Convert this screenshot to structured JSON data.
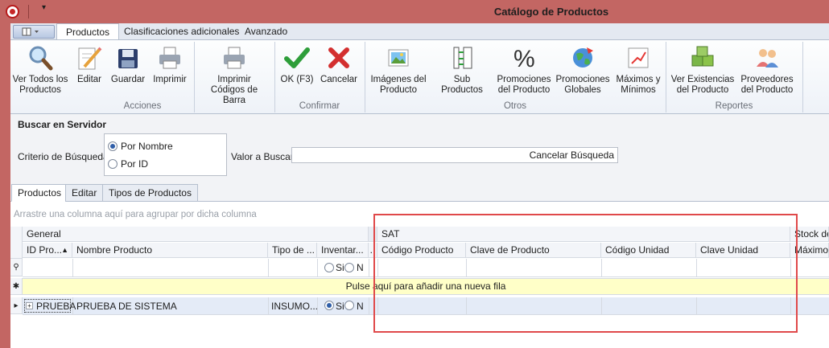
{
  "window": {
    "title": "Catálogo de Productos"
  },
  "ribbon_tabs": [
    "Productos",
    "Clasificaciones adicionales",
    "Avanzado"
  ],
  "ribbon": {
    "buttons": [
      {
        "label": "Ver Todos los Productos",
        "icon": "magnifier-icon"
      },
      {
        "label": "Editar",
        "icon": "pencil-paper-icon"
      },
      {
        "label": "Guardar",
        "icon": "floppy-disk-icon"
      },
      {
        "label": "Imprimir",
        "icon": "printer-icon"
      },
      {
        "label": "Imprimir Códigos de Barra",
        "icon": "printer-icon"
      },
      {
        "label": "OK (F3)",
        "icon": "green-check-icon"
      },
      {
        "label": "Cancelar",
        "icon": "red-x-icon"
      },
      {
        "label": "Imágenes del Producto",
        "icon": "picture-icon"
      },
      {
        "label": "Sub Productos",
        "icon": "tree-icon"
      },
      {
        "label": "Promociones del Producto",
        "icon": "percent-icon"
      },
      {
        "label": "Promociones Globales",
        "icon": "globe-icon"
      },
      {
        "label": "Máximos y Mínimos",
        "icon": "chart-icon"
      },
      {
        "label": "Ver Existencias del Producto",
        "icon": "boxes-icon"
      },
      {
        "label": "Proveedores del Producto",
        "icon": "people-icon"
      }
    ],
    "groups": [
      "Acciones",
      "Confirmar",
      "Otros",
      "Reportes"
    ]
  },
  "search": {
    "title": "Buscar en Servidor",
    "criteria_label": "Criterio de Búsqueda",
    "options": [
      "Por Nombre",
      "Por ID"
    ],
    "selected": "Por Nombre",
    "value_label": "Valor a Buscar",
    "value": "",
    "cancel_label": "Cancelar Búsqueda"
  },
  "tabs": [
    "Productos",
    "Editar",
    "Tipos de Productos"
  ],
  "grid": {
    "group_hint": "Arrastre una columna aquí para agrupar por dicha columna",
    "bands": [
      "General",
      "SAT",
      "Stock de"
    ],
    "columns": [
      "ID Pro...",
      "Nombre Producto",
      "Tipo de ...",
      "Inventar...",
      "Código Producto",
      "Clave de Producto",
      "Código Unidad",
      "Clave Unidad",
      "Máximo"
    ],
    "filter_radio": {
      "si": "Si",
      "no": "N"
    },
    "new_row_text": "Pulse aquí para añadir una nueva fila",
    "rows": [
      {
        "id": "PRUEBA",
        "nombre": "PRUEBA DE SISTEMA",
        "tipo": "INSUMO...",
        "inventariable": "Si",
        "no": "N"
      }
    ]
  },
  "colors": {
    "titlebar": "#c36663",
    "accent": "#2f5ea8",
    "highlight_box": "#e0494a",
    "new_row": "#ffffc8"
  }
}
